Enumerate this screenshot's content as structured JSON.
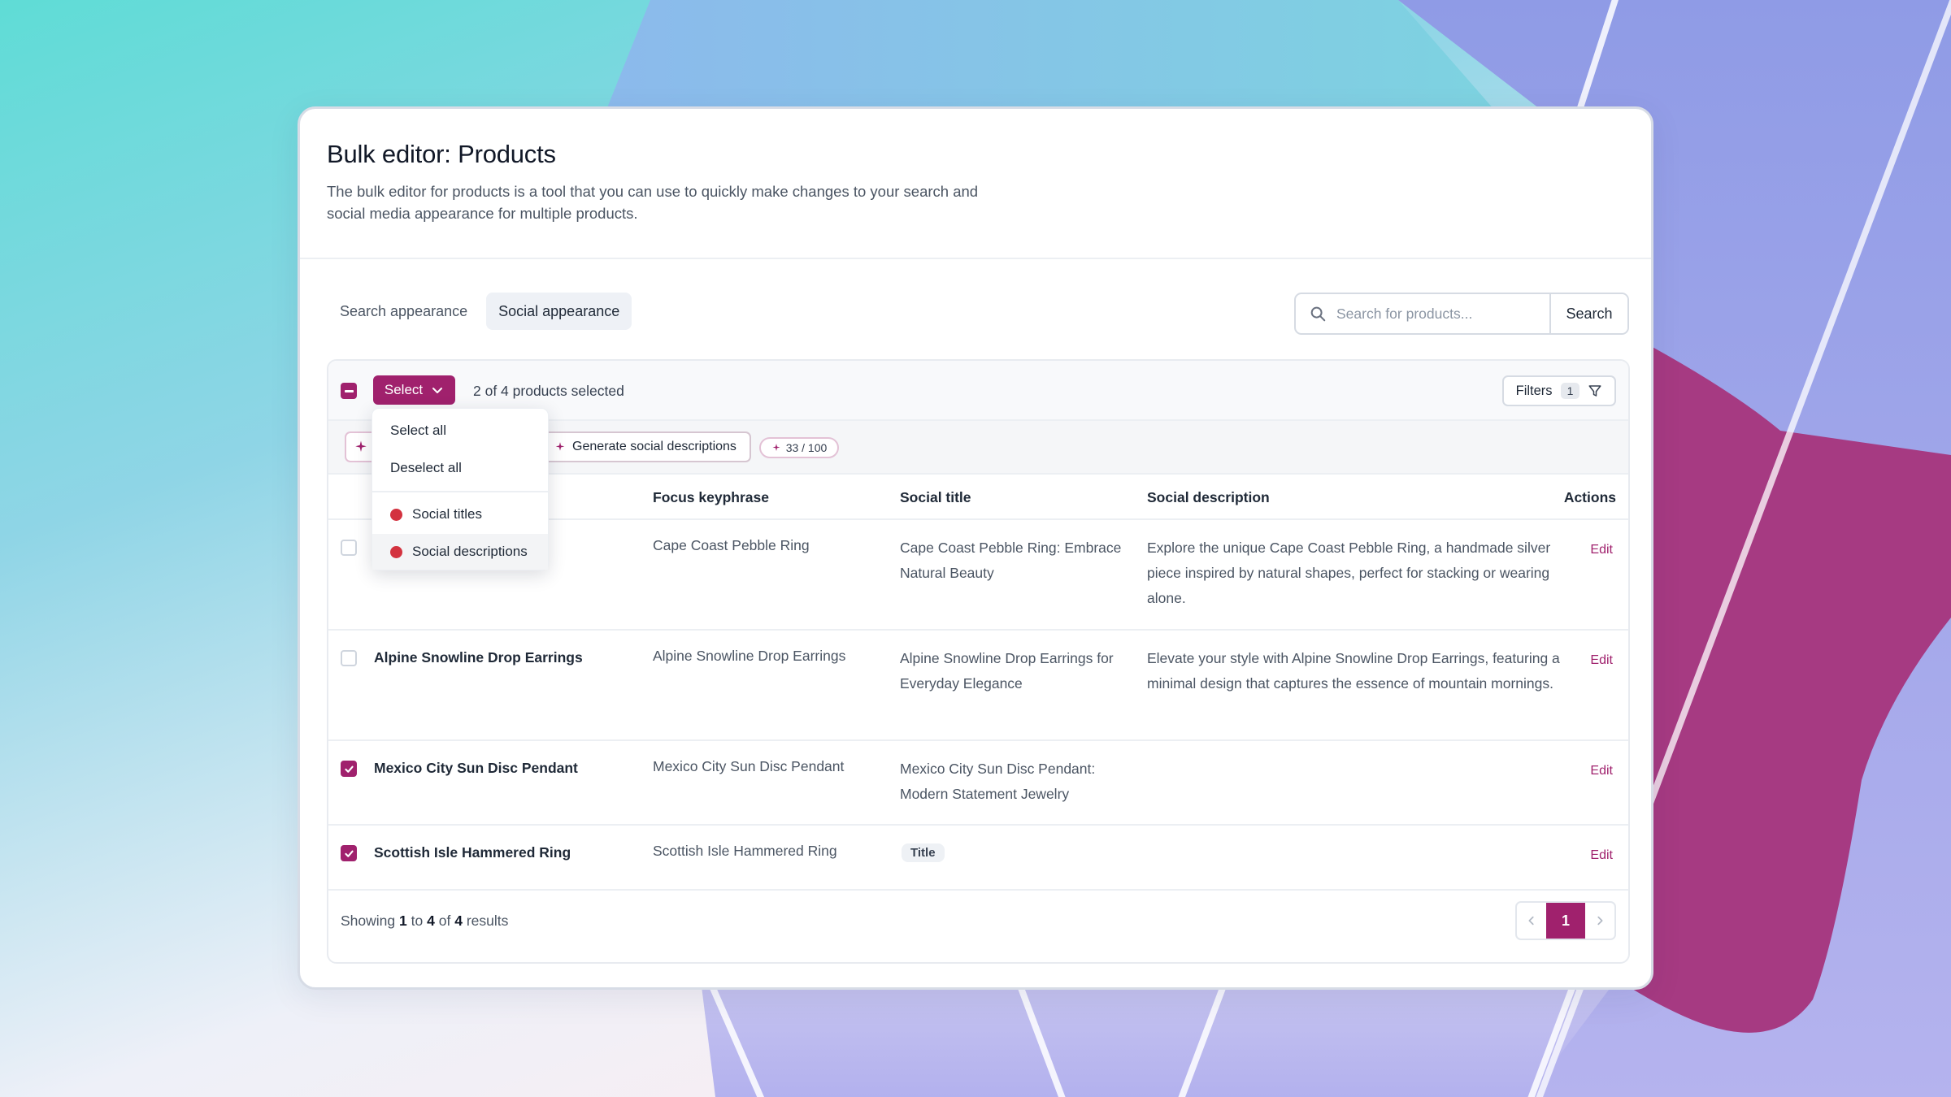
{
  "page": {
    "title": "Bulk editor: Products",
    "description": "The bulk editor for products is a tool that you can use to quickly make changes to your search and social media appearance for multiple products."
  },
  "tabs": [
    {
      "label": "Search appearance",
      "active": false
    },
    {
      "label": "Social appearance",
      "active": true
    }
  ],
  "search": {
    "placeholder": "Search for products...",
    "button_label": "Search"
  },
  "toolbar": {
    "select_label": "Select",
    "selected_text": "2 of 4 products selected",
    "filters_label": "Filters",
    "filters_count": "1"
  },
  "ai_bar": {
    "generate_label": "Generate social descriptions",
    "usage": "33 / 100"
  },
  "dropdown": {
    "items": [
      "Select all",
      "Deselect all"
    ],
    "status_items": [
      "Social titles",
      "Social descriptions"
    ],
    "status_color": "#d3323f"
  },
  "table": {
    "headers": {
      "focus_keyphrase": "Focus keyphrase",
      "social_title": "Social title",
      "social_description": "Social description",
      "actions": "Actions"
    },
    "edit_label": "Edit",
    "rows": [
      {
        "name": "",
        "keyphrase": "Cape Coast Pebble Ring",
        "social_title": "Cape Coast Pebble Ring: Embrace Natural Beauty",
        "social_description": "Explore the unique Cape Coast Pebble Ring, a handmade silver piece inspired by natural shapes, perfect for stacking or wearing alone.",
        "checked": false
      },
      {
        "name": "Alpine Snowline Drop Earrings",
        "keyphrase": "Alpine Snowline Drop Earrings",
        "social_title": "Alpine Snowline Drop Earrings for Everyday Elegance",
        "social_description": "Elevate your style with Alpine Snowline Drop Earrings, featuring a minimal design that captures the essence of mountain mornings.",
        "checked": false
      },
      {
        "name": "Mexico City Sun Disc Pendant",
        "keyphrase": "Mexico City Sun Disc Pendant",
        "social_title": "Mexico City Sun Disc Pendant: Modern Statement Jewelry",
        "social_description": "",
        "checked": true
      },
      {
        "name": "Scottish Isle Hammered Ring",
        "keyphrase": "Scottish Isle Hammered Ring",
        "social_title_pill": "Title",
        "social_description": "",
        "checked": true
      }
    ]
  },
  "footer": {
    "prefix": "Showing",
    "from": "1",
    "to_word": "to",
    "to": "4",
    "of_word": "of",
    "total": "4",
    "suffix": "results",
    "current_page": "1"
  },
  "colors": {
    "accent": "#a0216d",
    "error_dot": "#d3323f"
  }
}
